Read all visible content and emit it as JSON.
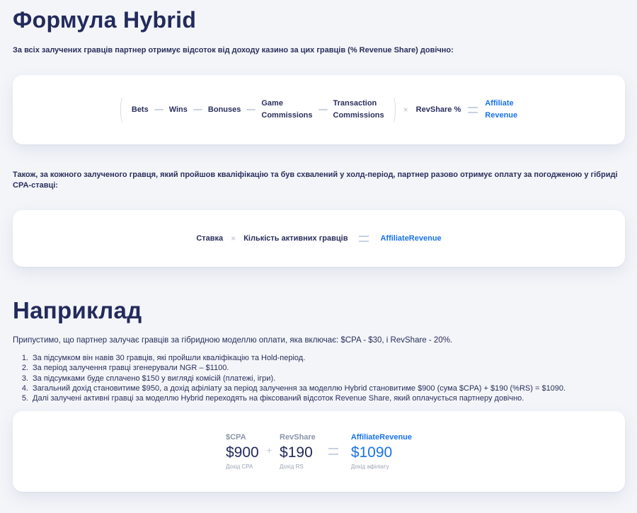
{
  "section1": {
    "title": "Формула Hybrid",
    "intro": "За всіх залучених гравців партнер отримує відсоток від доходу казино за цих гравців (% Revenue Share) довічно:",
    "formula": {
      "bets": "Bets",
      "wins": "Wins",
      "bonuses": "Bonuses",
      "game_commissions_1": "Game",
      "game_commissions_2": "Commissions",
      "transaction_commissions_1": "Transaction",
      "transaction_commissions_2": "Commissions",
      "times": "×",
      "revshare": "RevShare %",
      "result_1": "Affiliate",
      "result_2": "Revenue"
    },
    "intro2": "Також, за кожного залученого гравця, який пройшов кваліфікацію та був схвалений у холд-період, партнер разово отримує оплату за погодженою у гібриді CPA-ставці:",
    "formula2": {
      "rate": "Ставка",
      "times": "×",
      "count": "Кількість активних гравців",
      "result": "AffiliateRevenue"
    }
  },
  "section2": {
    "title": "Наприклад",
    "intro": "Припустимо, що партнер залучає гравців за гібридною моделлю оплати, яка включає: $CPA - $30, і RevShare - 20%.",
    "items": [
      {
        "num": "1.",
        "text": "За підсумком він навів 30 гравців, які пройшли кваліфікацію та Hold-період."
      },
      {
        "num": "2.",
        "text": "За період залучення гравці згенерували NGR – $1100."
      },
      {
        "num": "3.",
        "text": "За підсумками буде сплачено $150 у вигляді комісій (платежі, ігри)."
      },
      {
        "num": "4.",
        "text": "Загальний дохід становитиме $950, а дохід афіліату за період залучення за моделлю Hybrid становитиме $900 (сума $CPA) + $190 (%RS) = $1090."
      },
      {
        "num": "5.",
        "text": "Далі залучені активні гравці за моделлю Hybrid переходять на фіксований відсоток Revenue Share, який оплачується партнеру довічно."
      }
    ],
    "calc": {
      "cpa_head": "$CPA",
      "cpa_val": "$900",
      "cpa_sub": "Дохід CPA",
      "plus": "+",
      "rs_head": "RevShare",
      "rs_val": "$190",
      "rs_sub": "Дохід RS",
      "res_head": "AffiliateRevenue",
      "res_val": "$1090",
      "res_sub": "Дохід афіліату"
    }
  },
  "colors": {
    "accent": "#1a73e8",
    "heading": "#232a5c",
    "background": "#f3f5f9"
  }
}
